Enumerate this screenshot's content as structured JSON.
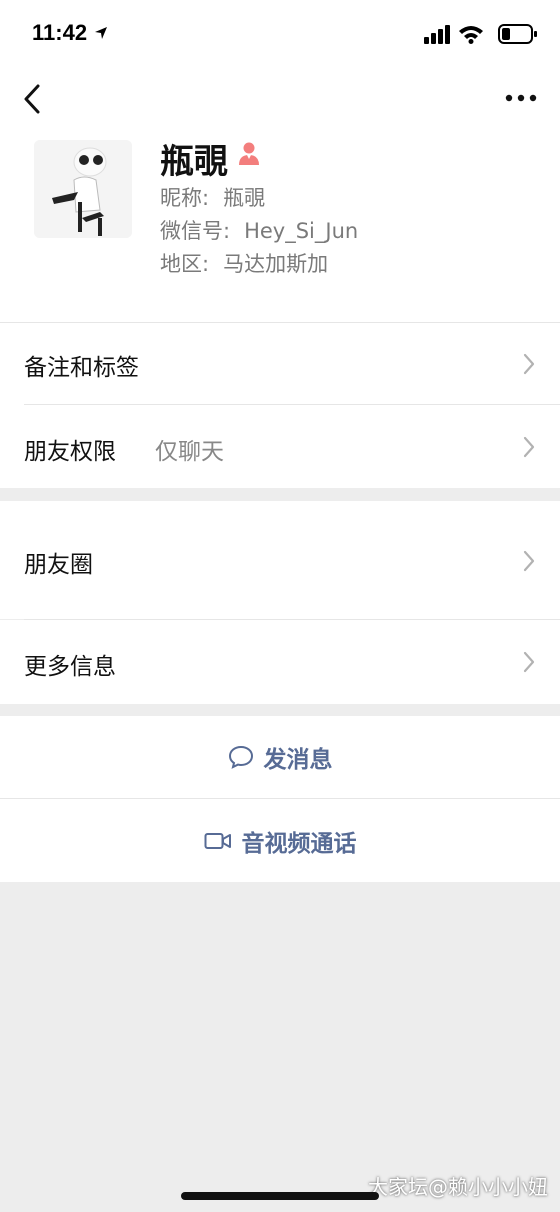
{
  "status_bar": {
    "time": "11:42"
  },
  "profile": {
    "name": "瓶覗",
    "nickname_label": "昵称:",
    "nickname": "瓶覗",
    "wechat_id_label": "微信号:",
    "wechat_id": "Hey_Si_Jun",
    "region_label": "地区:",
    "region": "马达加斯加"
  },
  "settings": {
    "remarks_tags": "备注和标签",
    "friend_permissions": "朋友权限",
    "friend_permissions_value": "仅聊天",
    "moments": "朋友圈",
    "more_info": "更多信息"
  },
  "actions": {
    "send_message": "发消息",
    "video_call": "音视频通话"
  },
  "watermark": "大家坛@赖小小小妞",
  "colors": {
    "link_blue": "#576b95",
    "background": "#ededed",
    "gender_female": "#f37e7d"
  }
}
